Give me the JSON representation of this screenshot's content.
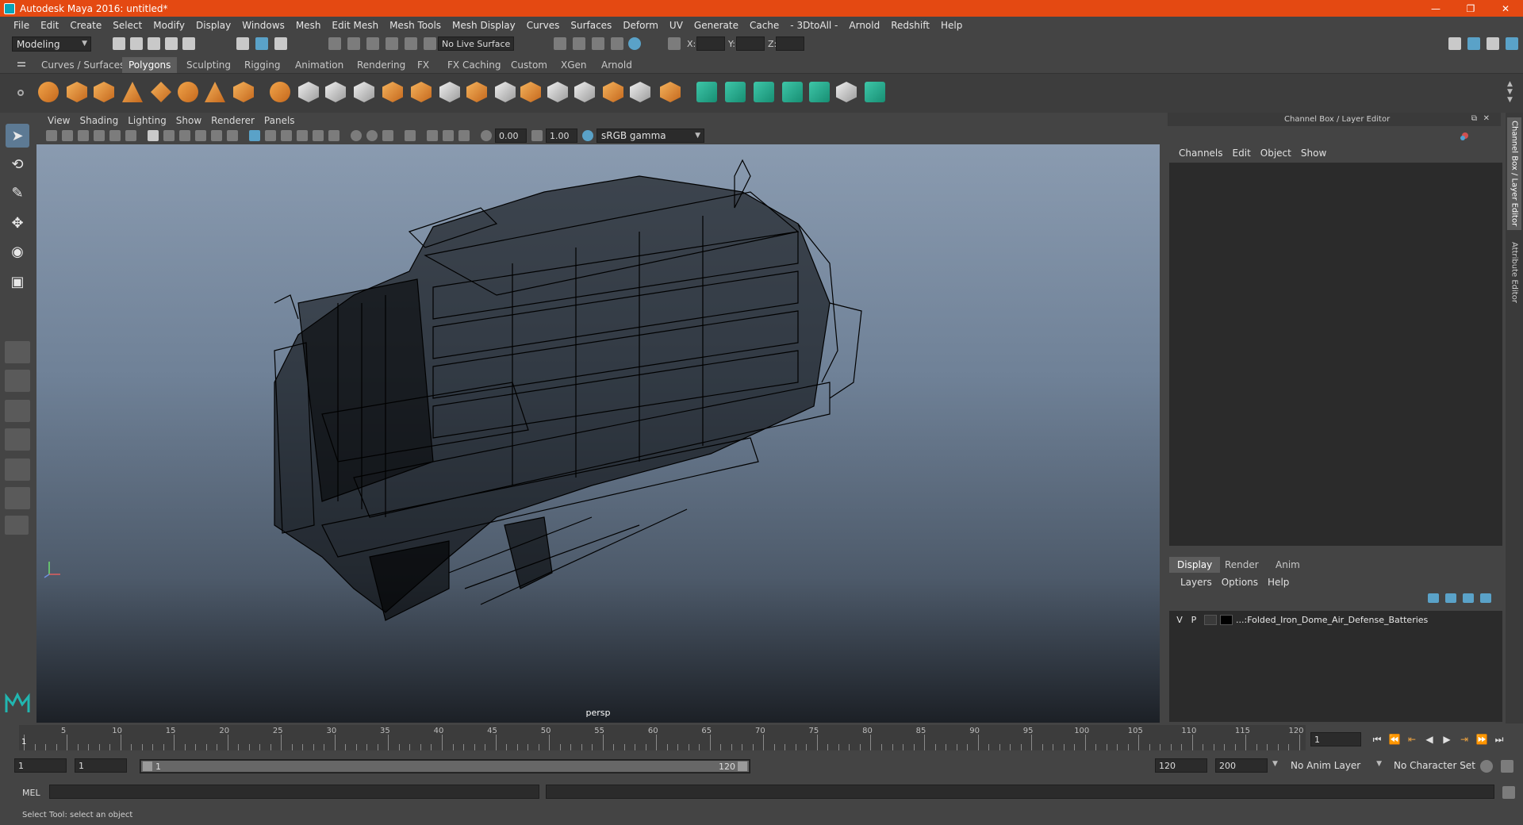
{
  "titlebar": {
    "title": "Autodesk Maya 2016: untitled*",
    "minimize": "—",
    "restore": "❐",
    "close": "✕"
  },
  "menubar": {
    "items": [
      "File",
      "Edit",
      "Create",
      "Select",
      "Modify",
      "Display",
      "Windows",
      "Mesh",
      "Edit Mesh",
      "Mesh Tools",
      "Mesh Display",
      "Curves",
      "Surfaces",
      "Deform",
      "UV",
      "Generate",
      "Cache",
      "- 3DtoAll -",
      "Arnold",
      "Redshift",
      "Help"
    ]
  },
  "statusline": {
    "mode": "Modeling",
    "live_surface": "No Live Surface",
    "x_label": "X:",
    "y_label": "Y:",
    "z_label": "Z:"
  },
  "shelf_tabs": {
    "items": [
      "Curves / Surfaces",
      "Polygons",
      "Sculpting",
      "Rigging",
      "Animation",
      "Rendering",
      "FX",
      "FX Caching",
      "Custom",
      "XGen",
      "Arnold"
    ],
    "active": "Polygons"
  },
  "viewport": {
    "menu": [
      "View",
      "Shading",
      "Lighting",
      "Show",
      "Renderer",
      "Panels"
    ],
    "exposure": "0.00",
    "gamma": "1.00",
    "color_space": "sRGB gamma",
    "camera": "persp"
  },
  "channel_box": {
    "header": "Channel Box / Layer Editor",
    "menu": [
      "Channels",
      "Edit",
      "Object",
      "Show"
    ]
  },
  "layer_editor": {
    "tabs": [
      "Display",
      "Render",
      "Anim"
    ],
    "active_tab": "Display",
    "menu": [
      "Layers",
      "Options",
      "Help"
    ],
    "layers": [
      {
        "v": "V",
        "p": "P",
        "name": "...:Folded_Iron_Dome_Air_Defense_Batteries"
      }
    ]
  },
  "side_tabs": [
    "Channel Box / Layer Editor",
    "Attribute Editor"
  ],
  "timeline": {
    "ticks": [
      1,
      5,
      10,
      15,
      20,
      25,
      30,
      35,
      40,
      45,
      50,
      55,
      60,
      65,
      70,
      75,
      80,
      85,
      90,
      95,
      100,
      105,
      110,
      115,
      120
    ],
    "labels": [
      "5",
      "10",
      "15",
      "20",
      "25",
      "30",
      "35",
      "40",
      "45",
      "50",
      "55",
      "60",
      "65",
      "70",
      "75",
      "80",
      "85",
      "90",
      "95",
      "100",
      "105",
      "110",
      "115",
      "120"
    ],
    "current_label": "1",
    "current_frame": "1"
  },
  "range": {
    "start": "1",
    "playback_start": "1",
    "slider_start": "1",
    "slider_end": "120",
    "playback_end": "120",
    "end": "200",
    "anim_layer": "No Anim Layer",
    "character_set": "No Character Set"
  },
  "cmdline": {
    "label": "MEL"
  },
  "helpline": {
    "text": "Select Tool: select an object"
  },
  "colors": {
    "title_bar": "#e44912",
    "accent": "#5d7a94",
    "viewport_top": "#8a9bb0",
    "viewport_bottom": "#1c2026"
  }
}
